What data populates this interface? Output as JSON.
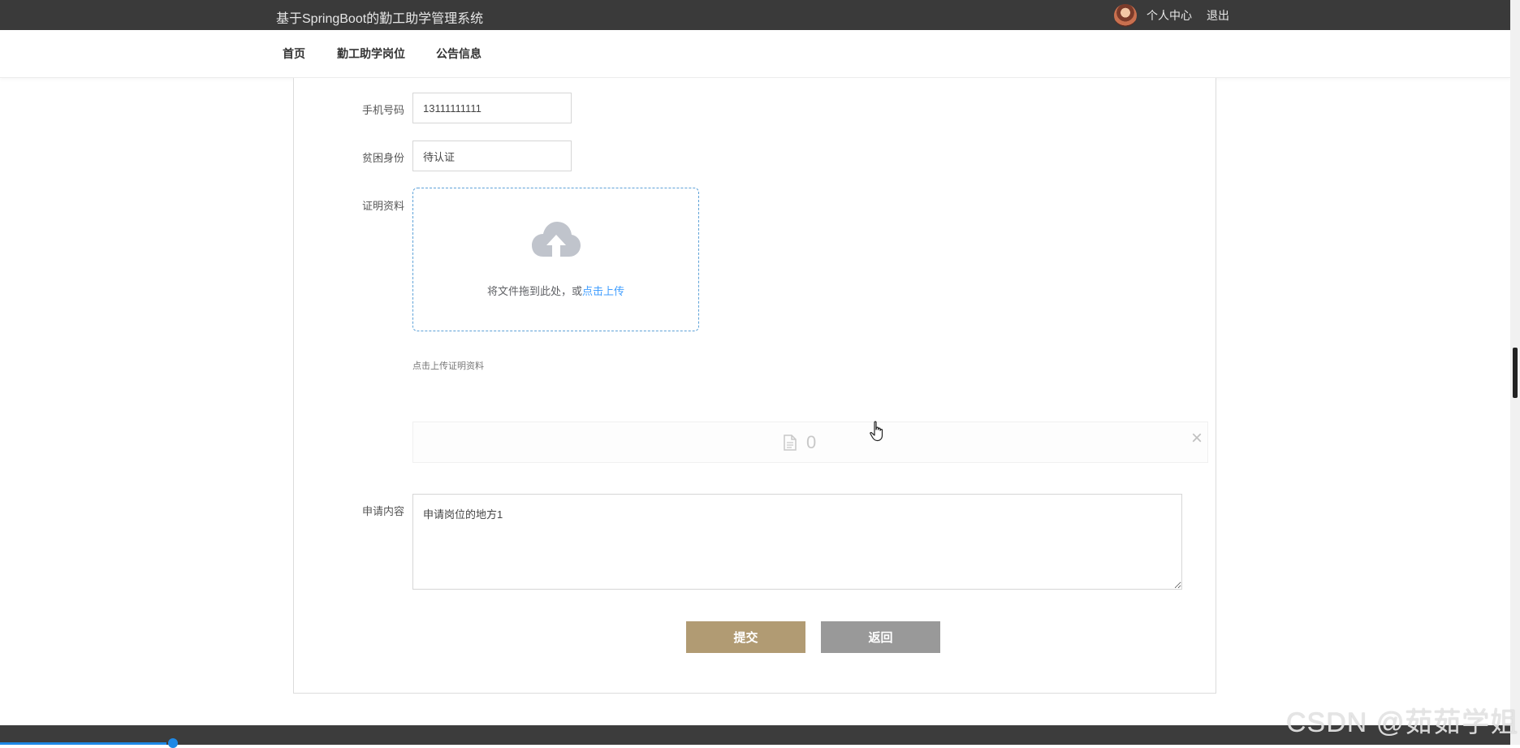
{
  "header": {
    "site_title": "基于SpringBoot的勤工助学管理系统",
    "user_center": "个人中心",
    "logout": "退出"
  },
  "nav": {
    "items": [
      "首页",
      "勤工助学岗位",
      "公告信息"
    ]
  },
  "form": {
    "phone": {
      "label": "手机号码",
      "value": "13111111111"
    },
    "poverty": {
      "label": "贫困身份",
      "value": "待认证"
    },
    "proof": {
      "label": "证明资料",
      "drop_text": "将文件拖到此处，或",
      "drop_link": "点击上传",
      "tip": "点击上传证明资料",
      "file_name": "0"
    },
    "content": {
      "label": "申请内容",
      "value": "申请岗位的地方1"
    },
    "submit": "提交",
    "back": "返回"
  },
  "watermark": "CSDN @茹茹学姐",
  "colors": {
    "topbar": "#3a3a3a",
    "submit_button": "#b19b73",
    "back_button": "#999999",
    "link": "#409eff"
  }
}
